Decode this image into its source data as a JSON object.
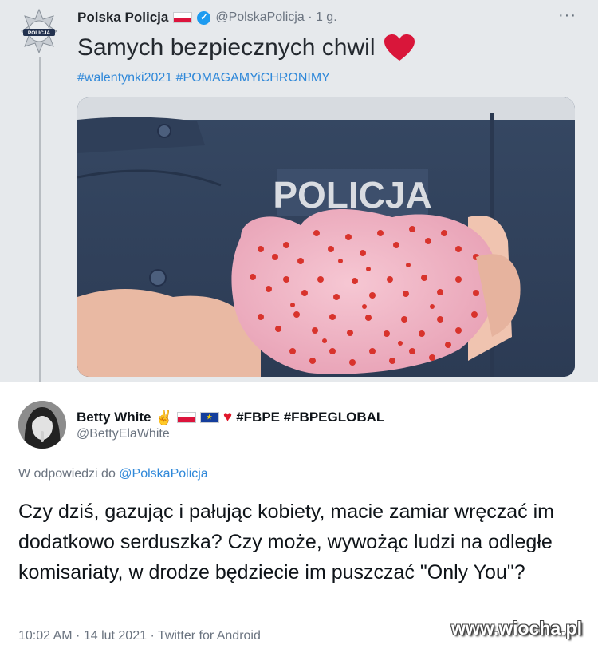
{
  "original_tweet": {
    "author_name": "Polska Policja",
    "handle_time": "@PolskaPolicja · 1 g.",
    "text": "Samych bezpiecznych chwil",
    "hashtags": "#walentynki2021 #POMAGAMYiCHRONIMY",
    "more_label": "···",
    "avatar_label": "POLICJA",
    "image_text": "POLICJA"
  },
  "reply": {
    "author_name": "Betty White",
    "name_tags": "#FBPE #FBPEGLOBAL",
    "handle": "@BettyElaWhite",
    "reply_to_prefix": "W odpowiedzi do",
    "reply_to_handle": "@PolskaPolicja",
    "text": "Czy dziś, gazując i pałując kobiety, macie zamiar wręczać im dodatkowo serduszka? Czy może, wywożąc ludzi na odległe komisariaty, w drodze będziecie im puszczać \"Only You\"?",
    "meta": "10:02 AM · 14 lut 2021 · Twitter for Android"
  },
  "watermark": "www.wiocha.pl",
  "colors": {
    "top_bg": "#e6e9ec",
    "link_blue": "#2f88d9",
    "heart_red": "#e0172b",
    "uniform_blue": "#3a4d6a",
    "donut_pink": "#f0b3c4"
  }
}
